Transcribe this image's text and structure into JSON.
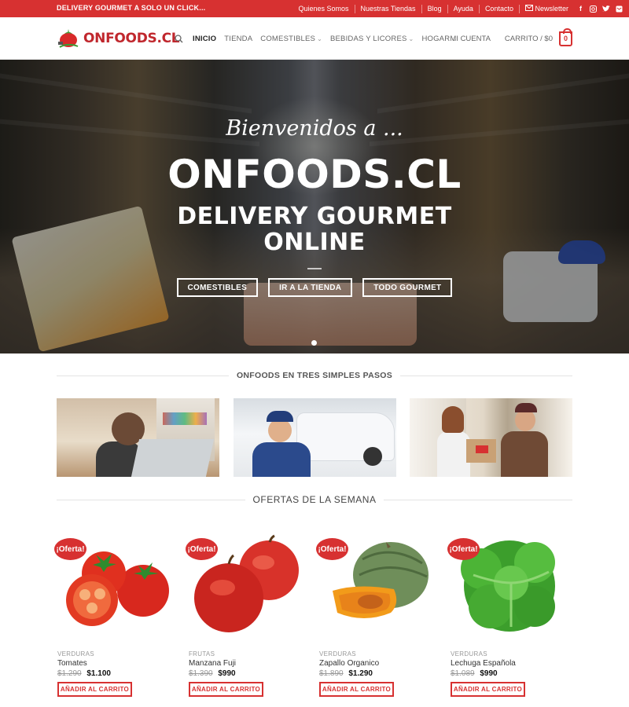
{
  "topbar": {
    "tagline": "DELIVERY GOURMET A SOLO UN CLICK...",
    "links": [
      "Quienes Somos",
      "Nuestras Tiendas",
      "Blog",
      "Ayuda",
      "Contacto"
    ],
    "newsletter": "Newsletter",
    "social_icons": [
      "facebook-icon",
      "instagram-icon",
      "twitter-icon",
      "mail-icon"
    ]
  },
  "header": {
    "logo_text": "ONFOODS.CL",
    "nav": [
      {
        "label": "INICIO",
        "active": true
      },
      {
        "label": "TIENDA"
      },
      {
        "label": "COMESTIBLES",
        "dropdown": true
      },
      {
        "label": "BEBIDAS Y LICORES",
        "dropdown": true
      },
      {
        "label": "HOGAR",
        "dropdown": true
      }
    ],
    "account": "MI CUENTA",
    "cart_label": "CARRITO / $0",
    "cart_count": "0"
  },
  "hero": {
    "welcome": "Bienvenidos a ...",
    "brand": "ONFOODS.CL",
    "line1": "DELIVERY GOURMET",
    "line2": "ONLINE",
    "buttons": [
      "COMESTIBLES",
      "IR A LA TIENDA",
      "TODO GOURMET"
    ]
  },
  "steps": {
    "title": "ONFOODS EN TRES SIMPLES PASOS"
  },
  "offers": {
    "title": "OFERTAS DE LA SEMANA",
    "badge": "¡Oferta!",
    "add_label": "AÑADIR AL CARRITO",
    "products": [
      {
        "category": "VERDURAS",
        "name": "Tomates",
        "old_price": "$1.290",
        "price": "$1.100"
      },
      {
        "category": "FRUTAS",
        "name": "Manzana Fuji",
        "old_price": "$1.390",
        "price": "$990"
      },
      {
        "category": "VERDURAS",
        "name": "Zapallo Organico",
        "old_price": "$1.890",
        "price": "$1.290"
      },
      {
        "category": "VERDURAS",
        "name": "Lechuga Española",
        "old_price": "$1.089",
        "price": "$990"
      }
    ]
  },
  "colors": {
    "accent": "#d73131",
    "topbar": "#d73131"
  }
}
